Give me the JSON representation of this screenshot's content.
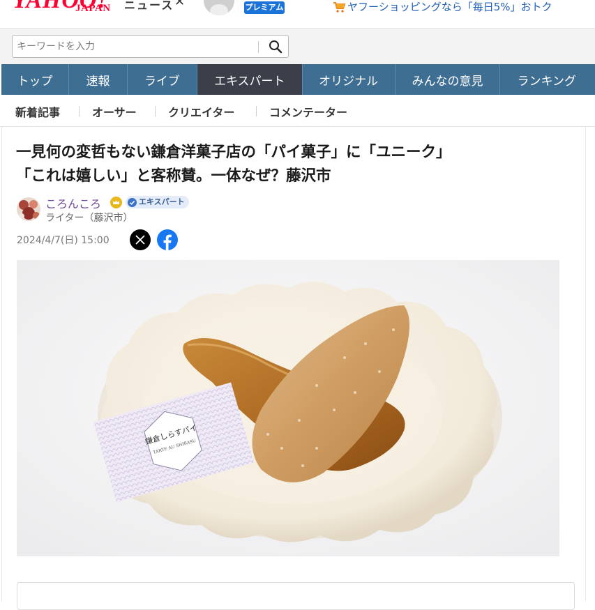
{
  "header": {
    "logo_text": "YAHOO!",
    "logo_sub": "JAPAN",
    "service_name_cut": "ニュース",
    "premium_label": "プレミアム",
    "shopping_promo": "ヤフーショッピングなら「毎日5%」おトク",
    "icons": [
      "avatar-icon",
      "cart-icon"
    ],
    "brand_color": "#ff0033"
  },
  "search": {
    "placeholder": "キーワードを入力",
    "value": "",
    "button_icon": "search-icon"
  },
  "global_nav": {
    "items": [
      {
        "label": "トップ",
        "active": false
      },
      {
        "label": "速報",
        "active": false
      },
      {
        "label": "ライブ",
        "active": false
      },
      {
        "label": "エキスパート",
        "active": true
      },
      {
        "label": "オリジナル",
        "active": false
      },
      {
        "label": "みんなの意見",
        "active": false
      },
      {
        "label": "ランキング",
        "active": false
      }
    ],
    "bg_color": "#3f6e93",
    "active_color": "#3a3f4a"
  },
  "sub_nav": {
    "items": [
      {
        "label": "新着記事"
      },
      {
        "label": "オーサー"
      },
      {
        "label": "クリエイター"
      },
      {
        "label": "コメンテーター"
      }
    ]
  },
  "article": {
    "headline_line1": "一見何の変哲もない鎌倉洋菓子店の「パイ菓子」に「ユニーク」",
    "headline_line2": "「これは嬉しい」と客称賛。一体なぜ？藤沢市",
    "author": {
      "name": "ころんころ",
      "badge": "エキスパート",
      "role": "ライター（藤沢市）"
    },
    "date": "2024/4/7(日) 15:00",
    "share_icons": [
      "x-icon",
      "facebook-icon"
    ],
    "image": {
      "card_text_jp": "鎌倉しらすパイ",
      "card_text_en": "TARTE AU SHIRASU"
    }
  }
}
